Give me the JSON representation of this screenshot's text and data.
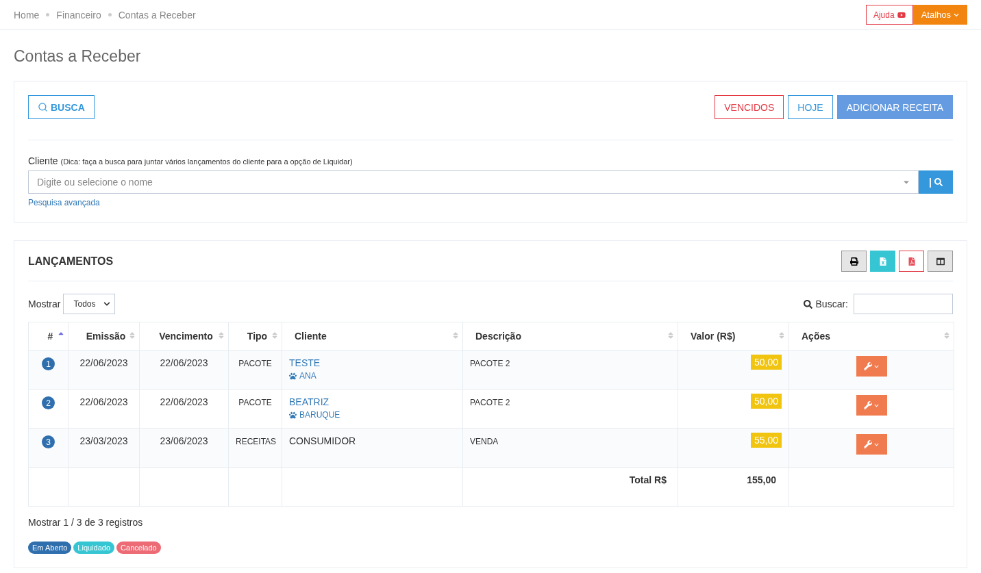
{
  "breadcrumb": [
    "Home",
    "Financeiro",
    "Contas a Receber"
  ],
  "header_buttons": {
    "help": "Ajuda",
    "shortcuts": "Atalhos"
  },
  "page_title": "Contas a Receber",
  "filter_panel": {
    "search_button": "BUSCA",
    "actions": [
      {
        "label": "VENCIDOS",
        "kind": "danger"
      },
      {
        "label": "HOJE",
        "kind": "info"
      },
      {
        "label": "ADICIONAR RECEITA",
        "kind": "primary"
      }
    ],
    "client_label": "Cliente",
    "client_hint": "(Dica: faça a busca para juntar vários lançamentos do cliente para a opção de Liquidar)",
    "client_field": {
      "placeholder": "Digite ou selecione o nome"
    },
    "search_addon": "|",
    "advanced_link": "Pesquisa avançada"
  },
  "entries": {
    "title": "LANÇAMENTOS",
    "show_label": "Mostrar",
    "show_select": "Todos",
    "search_label": "Buscar:",
    "columns": [
      {
        "label": "#",
        "sorted": true
      },
      {
        "label": "Emissão",
        "sorted": false
      },
      {
        "label": "Vencimento",
        "sorted": false
      },
      {
        "label": "Tipo",
        "sorted": false
      },
      {
        "label": "Cliente",
        "sorted": false
      },
      {
        "label": "Descrição",
        "sorted": false
      },
      {
        "label": "Valor (R$)",
        "sorted": false
      },
      {
        "label": "Ações",
        "sorted": false
      }
    ],
    "rows": [
      {
        "number": "1",
        "color": "#2f6fae",
        "issued": "22/06/2023",
        "due": "22/06/2023",
        "type": "PACOTE",
        "client": "TESTE",
        "pet": "ANA",
        "description": "PACOTE 2",
        "value": "50,00"
      },
      {
        "number": "2",
        "color": "#2f6fae",
        "issued": "22/06/2023",
        "due": "22/06/2023",
        "type": "PACOTE",
        "client": "BEATRIZ",
        "pet": "BARUQUE",
        "description": "PACOTE 2",
        "value": "50,00"
      },
      {
        "number": "3",
        "color": "#2f6fae",
        "issued": "23/03/2023",
        "due": "23/06/2023",
        "type": "RECEITAS",
        "client": "CONSUMIDOR",
        "description": "VENDA",
        "value": "55,00"
      }
    ],
    "total_label": "Total R$",
    "total_value": "155,00",
    "info": "Mostrar 1 / 3 de 3 registros",
    "legend": [
      {
        "label": "Em Aberto",
        "color": "#2f6fae"
      },
      {
        "label": "Liquidado",
        "color": "#36c6d3"
      },
      {
        "label": "Cancelado",
        "color": "#ed6b75"
      }
    ]
  }
}
